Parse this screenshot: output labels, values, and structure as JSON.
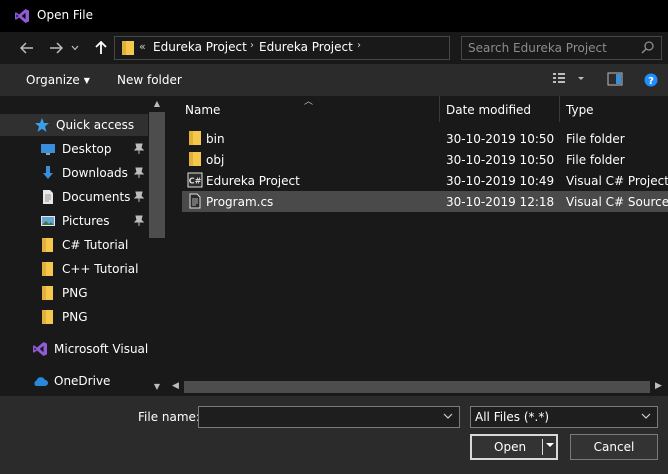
{
  "window": {
    "title": "Open File"
  },
  "address": {
    "overflow": "«",
    "crumbs": [
      "Edureka Project",
      "Edureka Project"
    ]
  },
  "search": {
    "placeholder": "Search Edureka Project"
  },
  "toolbar": {
    "organize": "Organize",
    "new_folder": "New folder"
  },
  "sidebar": {
    "items": [
      {
        "label": "Quick access",
        "icon": "star-icon",
        "pinned": false
      },
      {
        "label": "Desktop",
        "icon": "desktop-icon",
        "pinned": true
      },
      {
        "label": "Downloads",
        "icon": "download-icon",
        "pinned": true
      },
      {
        "label": "Documents",
        "icon": "documents-icon",
        "pinned": true
      },
      {
        "label": "Pictures",
        "icon": "pictures-icon",
        "pinned": true
      },
      {
        "label": "C# Tutorial",
        "icon": "folder-icon",
        "pinned": false
      },
      {
        "label": "C++ Tutorial",
        "icon": "folder-icon",
        "pinned": false
      },
      {
        "label": "PNG",
        "icon": "folder-icon",
        "pinned": false
      },
      {
        "label": "PNG",
        "icon": "folder-icon",
        "pinned": false
      },
      {
        "label": "Microsoft Visual S",
        "icon": "visual-studio-icon",
        "pinned": false
      },
      {
        "label": "OneDrive",
        "icon": "cloud-icon",
        "pinned": false
      }
    ]
  },
  "columns": {
    "name": "Name",
    "date": "Date modified",
    "type": "Type"
  },
  "files": [
    {
      "name": "bin",
      "date": "30-10-2019 10:50",
      "type": "File folder",
      "icon": "folder-icon"
    },
    {
      "name": "obj",
      "date": "30-10-2019 10:50",
      "type": "File folder",
      "icon": "folder-icon"
    },
    {
      "name": "Edureka Project",
      "date": "30-10-2019 10:49",
      "type": "Visual C# Project f...",
      "icon": "csharp-project-icon"
    },
    {
      "name": "Program.cs",
      "date": "30-10-2019 12:18",
      "type": "Visual C# Source F...",
      "icon": "source-file-icon"
    }
  ],
  "bottom": {
    "filename_label": "File name:",
    "filename_value": "",
    "filter_value": "All Files (*.*)",
    "open_label": "Open",
    "cancel_label": "Cancel"
  },
  "colors": {
    "folder": "#f5c84c",
    "accent_blue": "#1e90ff",
    "vs_purple": "#8f5bd6",
    "selected_row": "#4a4a4a"
  }
}
